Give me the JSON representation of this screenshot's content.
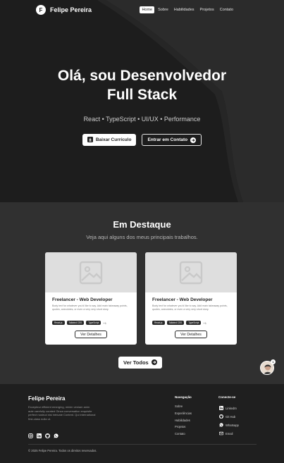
{
  "nav": {
    "logo_letter": "F",
    "brand": "Felipe Pereira",
    "links": [
      "Home",
      "Sobre",
      "Habilidades",
      "Projetos",
      "Contato"
    ],
    "active": "Home"
  },
  "hero": {
    "title_line1": "Olá, sou Desenvolvedor",
    "title_line2": "Full Stack",
    "subtitle": "React • TypeScript • UI/UX • Performance",
    "btn_cv": "Baixar Currículo",
    "btn_contact": "Entrar em Contato"
  },
  "featured": {
    "title": "Em Destaque",
    "subtitle": "Veja aqui alguns dos meus principais trabalhos.",
    "cards": [
      {
        "title": "Freelancer - Web Developer",
        "body": "Body text for whatever you'd like to say. Add main takeaway points, quotes, anecdotes, or even a very very short story.",
        "tags": [
          "React.js",
          "Tailwind CSS",
          "TypeScript"
        ],
        "more": "+1",
        "button": "Ver Detalhes"
      },
      {
        "title": "Freelancer - Web Developer",
        "body": "Body text for whatever you'd like to say. Add main takeaway points, quotes, anecdotes, or even a very very short story.",
        "tags": [
          "React.js",
          "Tailwind CSS",
          "TypeScript"
        ],
        "more": "+1",
        "button": "Ver Detalhes"
      }
    ],
    "view_all": "Ver Todos",
    "avatar_badge": "1"
  },
  "footer": {
    "name": "Felipe Pereira",
    "description": "Excepteur efficient emerging, minim veniam anim aute carefully curated Ginza conversation exquisite perfect nostrud nisi intricate Content. Qui international first-class nulla ut.",
    "nav_title": "Navegação",
    "nav_items": [
      "Sobre",
      "Experiências",
      "Habilidades",
      "Projetos",
      "Contato"
    ],
    "connect_title": "Conecte-se",
    "connect_items": [
      "LinkedIn",
      "Git Hub",
      "Whatsapp",
      "Email"
    ],
    "copyright": "© 2025 Felipe Pereira. Todos os direitos reservados."
  },
  "colors": {
    "dark": "#1f1f1f",
    "section": "#303030",
    "accent": "#ffffff"
  }
}
